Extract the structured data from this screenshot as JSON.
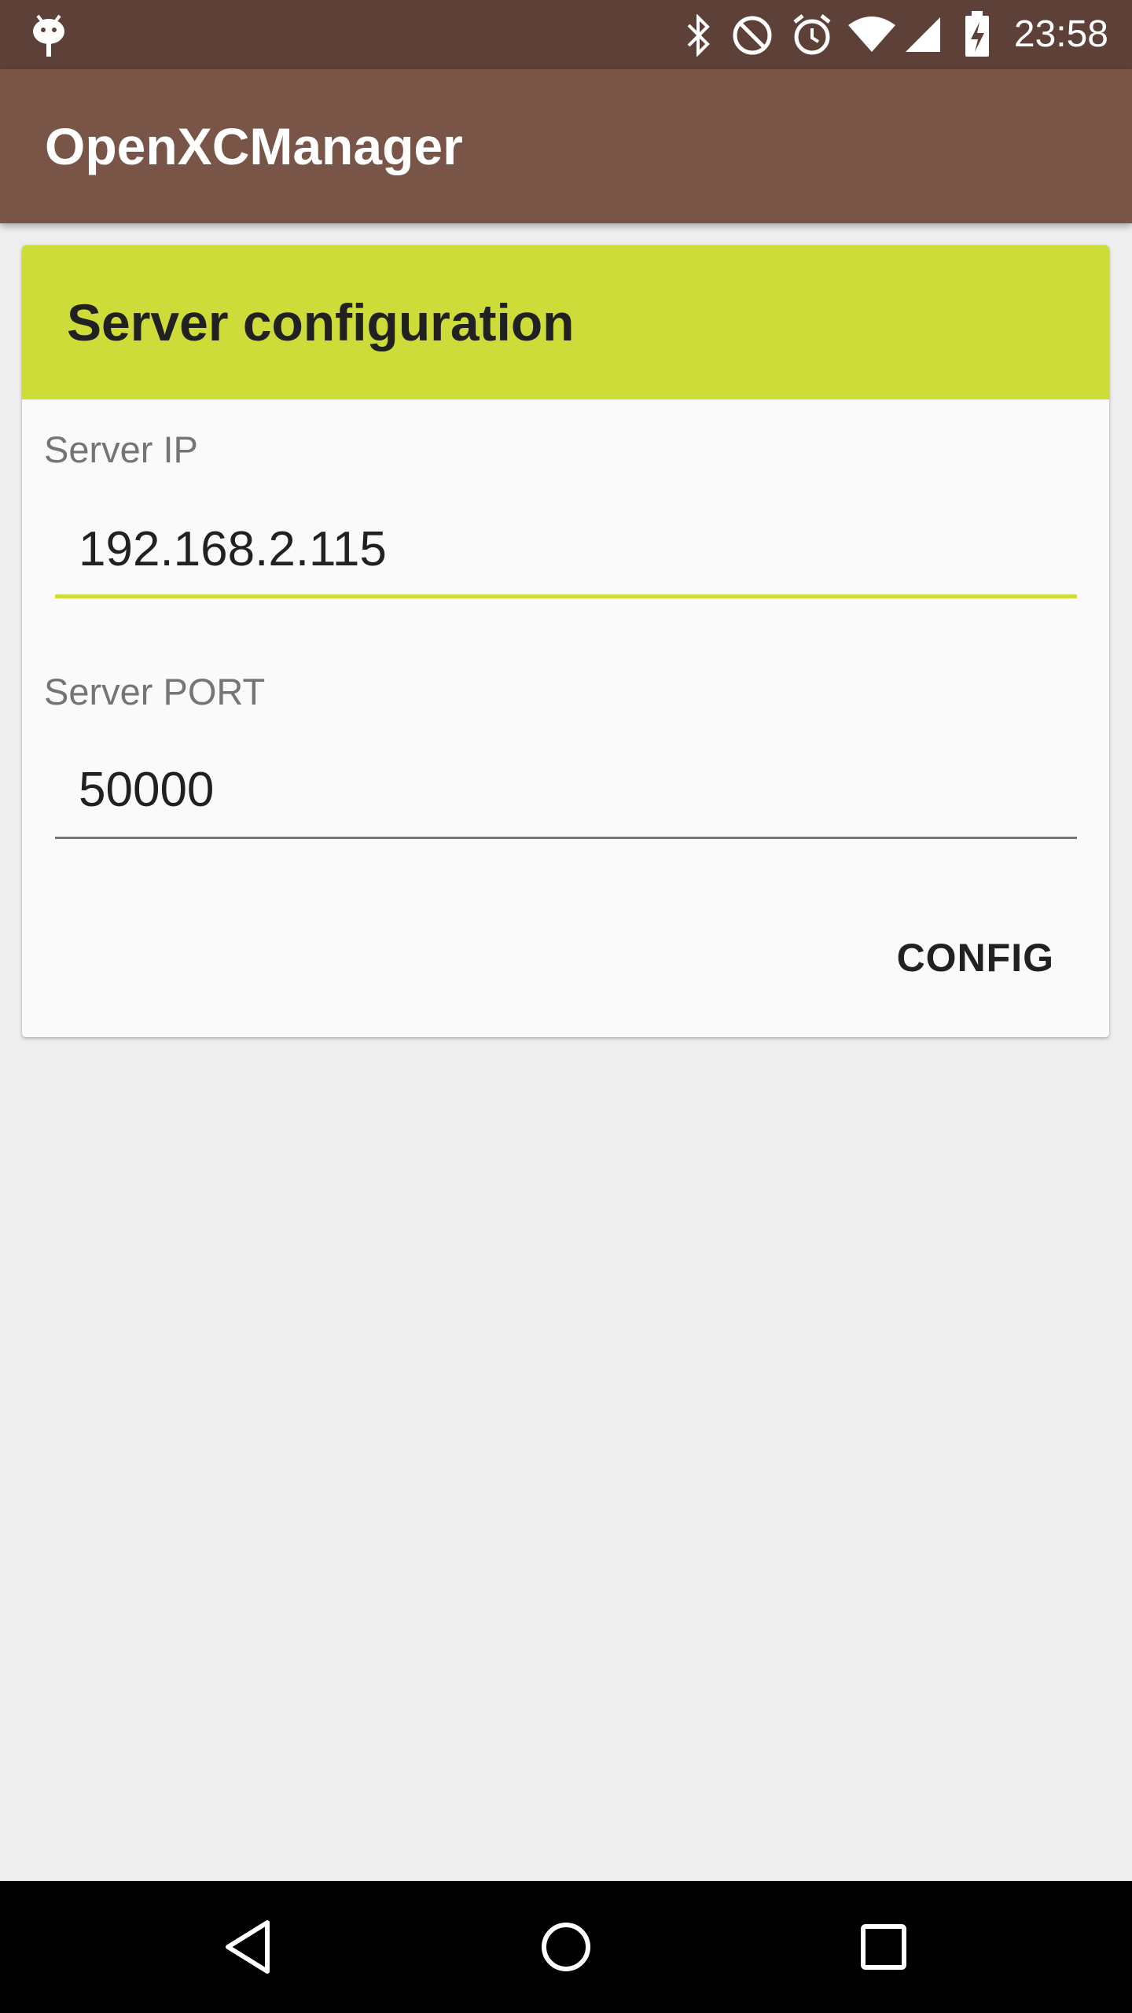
{
  "status_bar": {
    "time": "23:58",
    "icons": [
      "android-debug-icon",
      "bluetooth-icon",
      "do-not-disturb-icon",
      "alarm-icon",
      "wifi-icon",
      "cell-signal-icon",
      "battery-charging-icon"
    ]
  },
  "app_bar": {
    "title": "OpenXCManager"
  },
  "card": {
    "title": "Server configuration",
    "fields": [
      {
        "label": "Server IP",
        "value": "192.168.2.115",
        "focused": true
      },
      {
        "label": "Server PORT",
        "value": "50000",
        "focused": false
      }
    ],
    "button_label": "CONFIG"
  },
  "nav_bar": {
    "buttons": [
      "back-icon",
      "home-icon",
      "recents-icon"
    ]
  },
  "colors": {
    "status_bar": "#5d4037",
    "app_bar": "#795548",
    "card_header": "#cddc39",
    "focused_underline": "#cddc39",
    "background": "#eeeeee"
  }
}
